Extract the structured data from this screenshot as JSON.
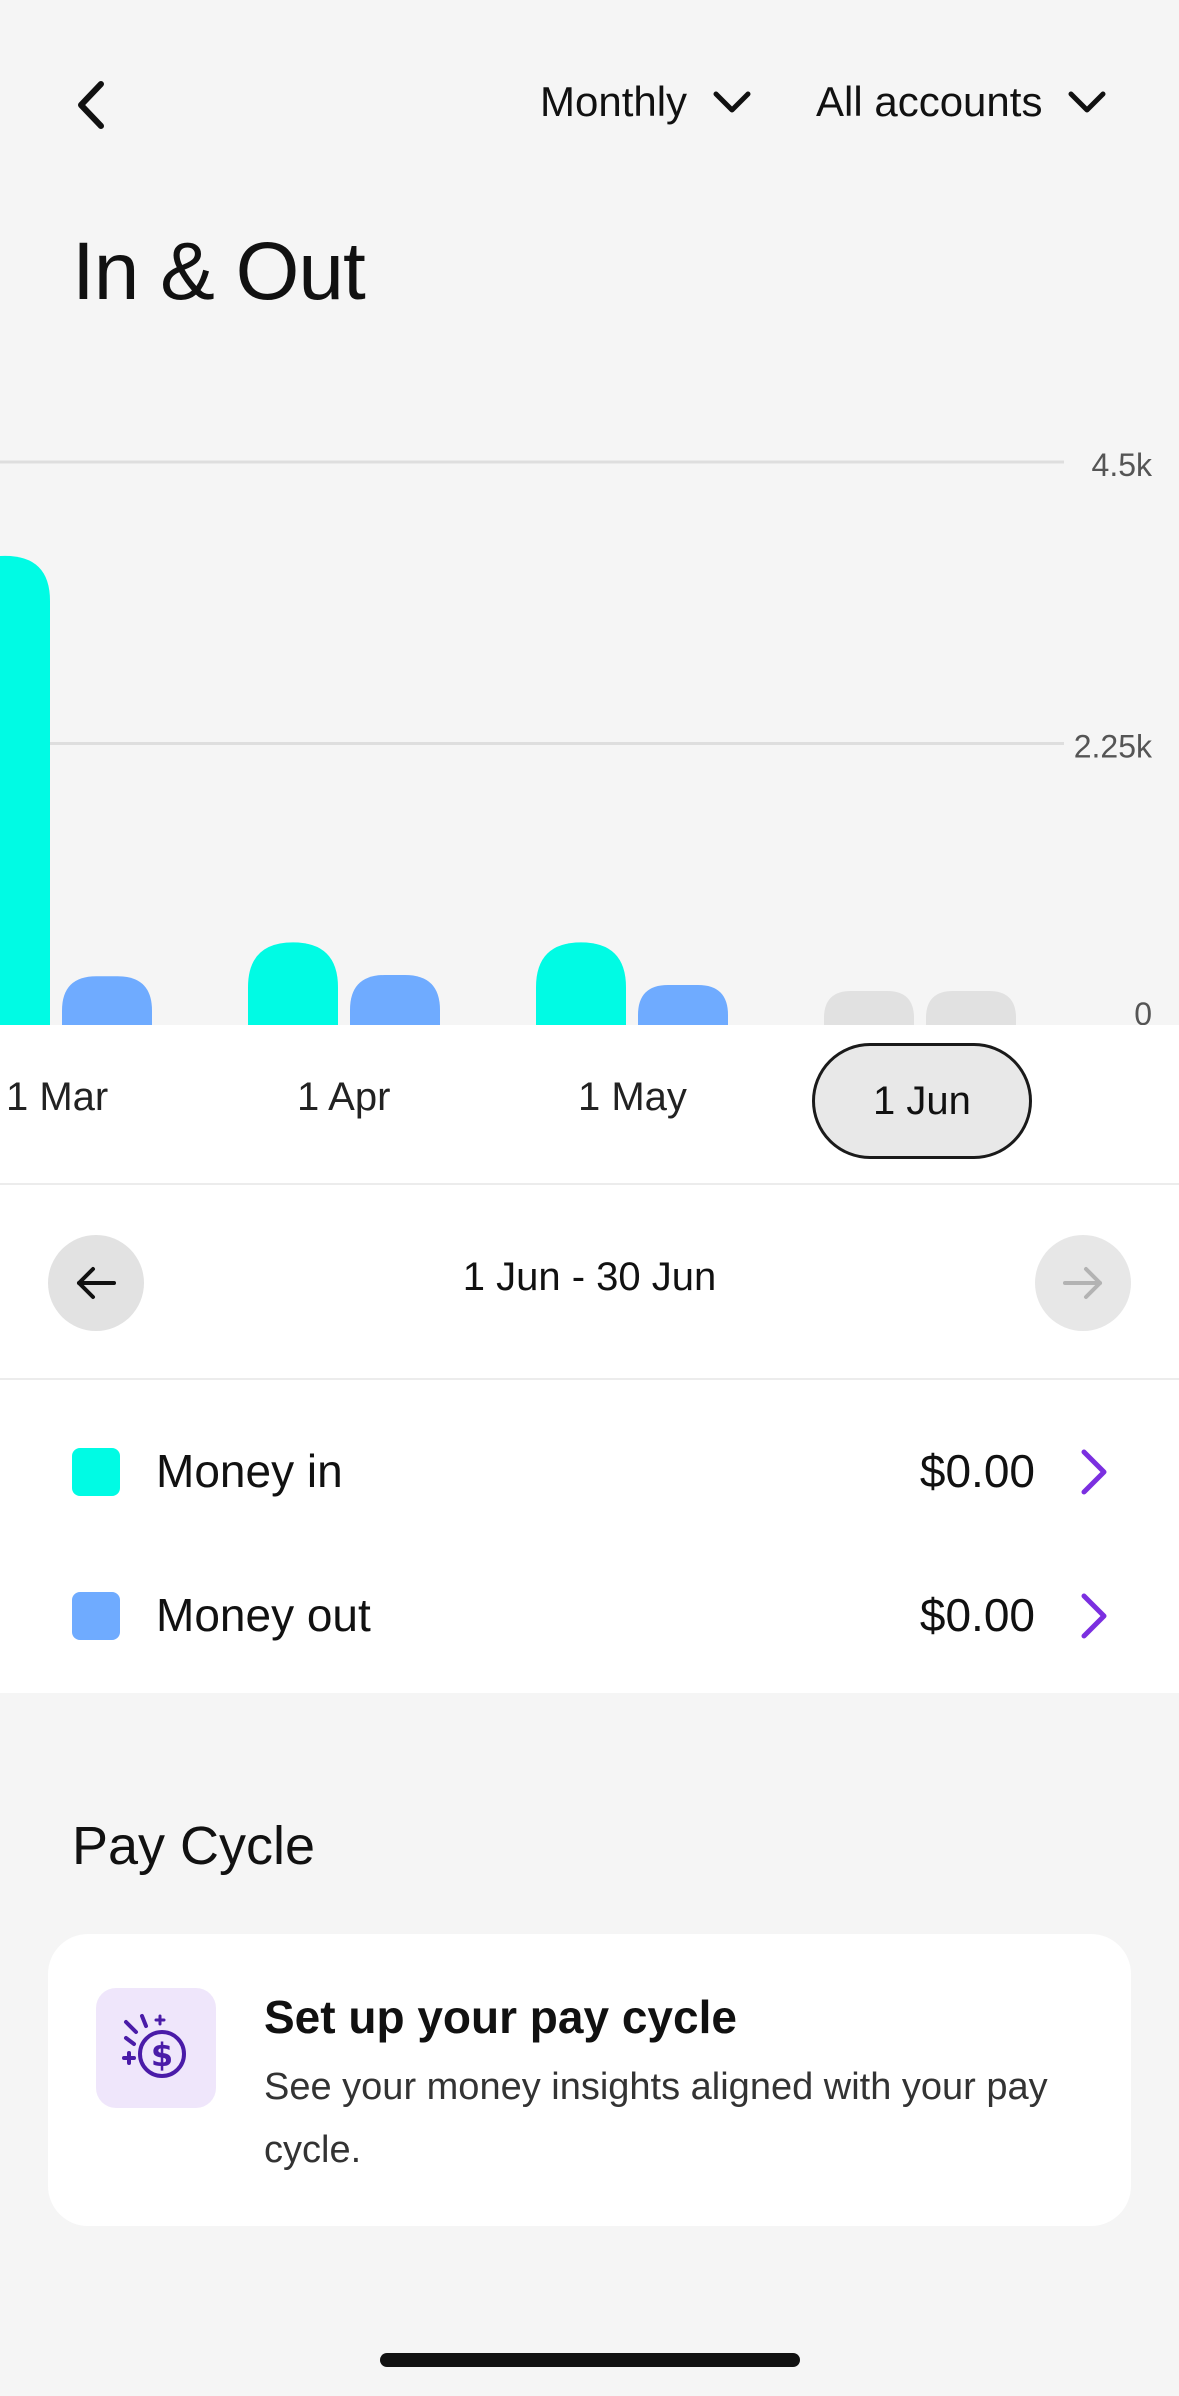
{
  "header": {
    "period_label": "Monthly",
    "account_label": "All accounts",
    "title": "In & Out"
  },
  "colors": {
    "money_in": "#00fbe4",
    "money_out": "#6fabff",
    "future_bar": "#e1e1e1",
    "accent": "#7b2fe0"
  },
  "chart_data": {
    "type": "bar",
    "categories": [
      "1 Mar",
      "1 Apr",
      "1 May",
      "1 Jun"
    ],
    "series": [
      {
        "name": "Money in",
        "values": [
          3750,
          660,
          660,
          0
        ]
      },
      {
        "name": "Money out",
        "values": [
          390,
          400,
          320,
          0
        ]
      }
    ],
    "ylim": [
      0,
      4500
    ],
    "yticks": [
      "4.5k",
      "2.25k",
      "0"
    ],
    "ytick_values": [
      4500,
      2250,
      0
    ],
    "grid": true,
    "selected_category": "1 Jun"
  },
  "range": {
    "label": "1 Jun - 30 Jun"
  },
  "legend": {
    "items": [
      {
        "label": "Money in",
        "value": "$0.00"
      },
      {
        "label": "Money out",
        "value": "$0.00"
      }
    ]
  },
  "pay_cycle": {
    "section_title": "Pay Cycle",
    "card_title": "Set up your pay cycle",
    "card_description": "See your money insights aligned with your pay cycle."
  }
}
